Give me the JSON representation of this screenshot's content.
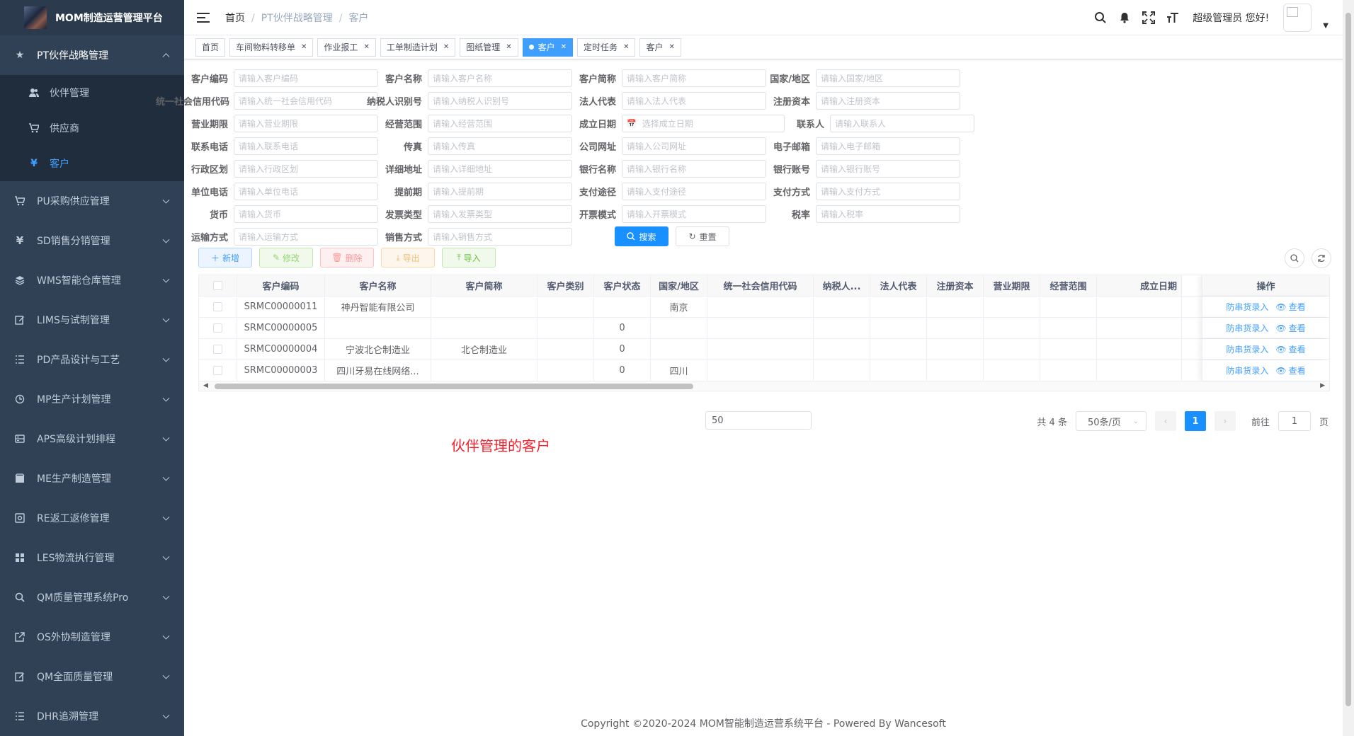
{
  "app": {
    "title": "MOM制造运营管理平台"
  },
  "sidebar": {
    "open_menu": {
      "label": "PT伙伴战略管理",
      "icon": "star-icon"
    },
    "sub_items": [
      {
        "label": "伙伴管理",
        "icon": "users-icon"
      },
      {
        "label": "供应商",
        "icon": "cart-icon"
      },
      {
        "label": "客户",
        "icon": "yen-icon",
        "active": true
      }
    ],
    "menus": [
      {
        "label": "PU采购供应管理",
        "icon": "cart-icon"
      },
      {
        "label": "SD销售分销管理",
        "icon": "yen-icon"
      },
      {
        "label": "WMS智能仓库管理",
        "icon": "layers-icon"
      },
      {
        "label": "LIMS与试制管理",
        "icon": "edit-icon"
      },
      {
        "label": "PD产品设计与工艺",
        "icon": "list-icon"
      },
      {
        "label": "MP生产计划管理",
        "icon": "clock-icon"
      },
      {
        "label": "APS高级计划排程",
        "icon": "server-icon"
      },
      {
        "label": "ME生产制造管理",
        "icon": "cube-icon"
      },
      {
        "label": "RE返工返修管理",
        "icon": "rework-icon"
      },
      {
        "label": "LES物流执行管理",
        "icon": "grid-icon"
      },
      {
        "label": "QM质量管理系统Pro",
        "icon": "search-icon"
      },
      {
        "label": "OS外协制造管理",
        "icon": "external-icon"
      },
      {
        "label": "QM全面质量管理",
        "icon": "edit-icon"
      },
      {
        "label": "DHR追溯管理",
        "icon": "list-icon"
      }
    ]
  },
  "navbar": {
    "breadcrumb": [
      "首页",
      "PT伙伴战略管理",
      "客户"
    ],
    "user_greeting": "超级管理员 您好!"
  },
  "tags": [
    {
      "label": "首页",
      "closable": false
    },
    {
      "label": "车间物料转移单",
      "closable": true
    },
    {
      "label": "作业报工",
      "closable": true
    },
    {
      "label": "工单制造计划",
      "closable": true
    },
    {
      "label": "图纸管理",
      "closable": true
    },
    {
      "label": "客户",
      "closable": true,
      "active": true
    },
    {
      "label": "定时任务",
      "closable": true
    },
    {
      "label": "客户",
      "closable": true
    }
  ],
  "form": {
    "rows": [
      [
        {
          "label": "客户编码",
          "placeholder": "请输入客户编码"
        },
        {
          "label": "客户名称",
          "placeholder": "请输入客户名称"
        },
        {
          "label": "客户简称",
          "placeholder": "请输入客户简称"
        },
        {
          "label": "国家/地区",
          "placeholder": "请输入国家/地区"
        }
      ],
      [
        {
          "label": "统一社会信用代码",
          "placeholder": "请输入统一社会信用代码"
        },
        {
          "label": "纳税人识别号",
          "placeholder": "请输入纳税人识别号"
        },
        {
          "label": "法人代表",
          "placeholder": "请输入法人代表"
        },
        {
          "label": "注册资本",
          "placeholder": "请输入注册资本"
        }
      ],
      [
        {
          "label": "营业期限",
          "placeholder": "请输入营业期限"
        },
        {
          "label": "经营范围",
          "placeholder": "请输入经营范围"
        },
        {
          "label": "成立日期",
          "placeholder": "选择成立日期",
          "date": true
        },
        {
          "label": "联系人",
          "placeholder": "请输入联系人"
        }
      ],
      [
        {
          "label": "联系电话",
          "placeholder": "请输入联系电话"
        },
        {
          "label": "传真",
          "placeholder": "请输入传真"
        },
        {
          "label": "公司网址",
          "placeholder": "请输入公司网址"
        },
        {
          "label": "电子邮箱",
          "placeholder": "请输入电子邮箱"
        }
      ],
      [
        {
          "label": "行政区划",
          "placeholder": "请输入行政区划"
        },
        {
          "label": "详细地址",
          "placeholder": "请输入详细地址"
        },
        {
          "label": "银行名称",
          "placeholder": "请输入银行名称"
        },
        {
          "label": "银行账号",
          "placeholder": "请输入银行账号"
        }
      ],
      [
        {
          "label": "单位电话",
          "placeholder": "请输入单位电话"
        },
        {
          "label": "提前期",
          "placeholder": "请输入提前期"
        },
        {
          "label": "支付途径",
          "placeholder": "请输入支付途径"
        },
        {
          "label": "支付方式",
          "placeholder": "请输入支付方式"
        }
      ],
      [
        {
          "label": "货币",
          "placeholder": "请输入货币"
        },
        {
          "label": "发票类型",
          "placeholder": "请输入发票类型"
        },
        {
          "label": "开票模式",
          "placeholder": "请输入开票模式"
        },
        {
          "label": "税率",
          "placeholder": "请输入税率"
        }
      ],
      [
        {
          "label": "运输方式",
          "placeholder": "请输入运输方式"
        },
        {
          "label": "销售方式",
          "placeholder": "请输入销售方式"
        }
      ]
    ],
    "search_label": "搜索",
    "reset_label": "重置"
  },
  "toolbar": {
    "add": "新增",
    "edit": "修改",
    "delete": "删除",
    "export": "导出",
    "import": "导入"
  },
  "table": {
    "columns": [
      "客户编码",
      "客户名称",
      "客户简称",
      "客户类别",
      "客户状态",
      "国家/地区",
      "统一社会信用代码",
      "纳税人...",
      "法人代表",
      "注册资本",
      "营业期限",
      "经营范围",
      "成立日期"
    ],
    "ops_header": "操作",
    "rows": [
      [
        "SRMC00000011",
        "神丹智能有限公司",
        "",
        "",
        "",
        "南京",
        "",
        "",
        "",
        "",
        "",
        "",
        ""
      ],
      [
        "SRMC00000005",
        "",
        "",
        "",
        "0",
        "",
        "",
        "",
        "",
        "",
        "",
        "",
        ""
      ],
      [
        "SRMC00000004",
        "宁波北仑制造业",
        "北仑制造业",
        "",
        "0",
        "",
        "",
        "",
        "",
        "",
        "",
        "",
        ""
      ],
      [
        "SRMC00000003",
        "四川牙易在线网络...",
        "",
        "",
        "0",
        "四川",
        "",
        "",
        "",
        "",
        "",
        "",
        ""
      ]
    ],
    "op_links": [
      "防串货录入",
      "查看"
    ]
  },
  "pagination": {
    "jump_value": "50",
    "total": "共 4 条",
    "page_size": "50条/页",
    "current": "1",
    "goto_label": "前往",
    "goto_value": "1",
    "page_unit": "页"
  },
  "annotation": "伙伴管理的客户",
  "footer": "Copyright ©2020-2024 MOM智能制造运营系统平台 - Powered By Wancesoft",
  "colors": {
    "sidebar_bg": "#304156",
    "submenu_bg": "#1f2d3d",
    "primary": "#1890ff",
    "annotation": "#f5222d"
  }
}
